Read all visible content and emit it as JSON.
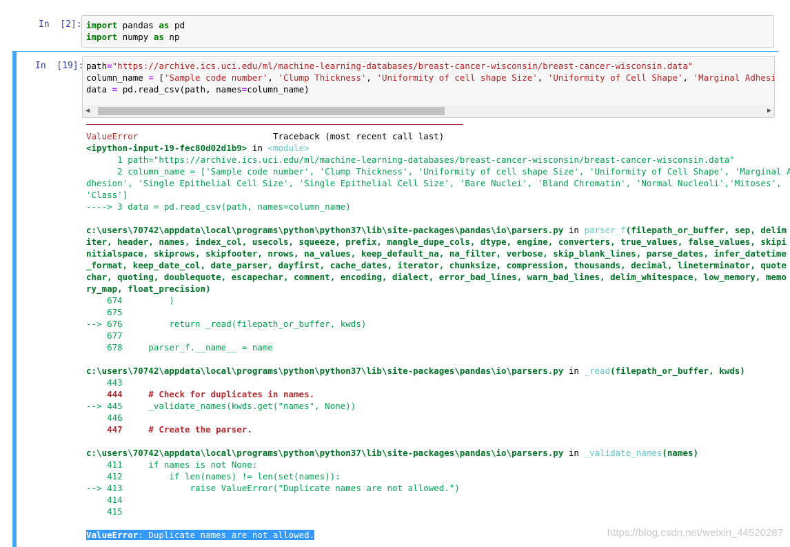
{
  "cell1": {
    "prompt": "In  [2]:",
    "lines": [
      "import pandas as pd",
      "import numpy as np"
    ]
  },
  "cell2": {
    "prompt": "In  [19]:",
    "line1": "path=\"https://archive.ics.uci.edu/ml/machine-learning-databases/breast-cancer-wisconsin/breast-cancer-wisconsin.data\"",
    "line2": "column_name = ['Sample code number', 'Clump Thickness', 'Uniformity of cell shape Size', 'Uniformity of Cell Shape', 'Marginal Adhesion', 'Sing",
    "line3": "data = pd.read_csv(path, names=column_name)"
  },
  "traceback": {
    "header_error": "ValueError",
    "header_traceback": "Traceback (most recent call last)",
    "frame1_loc": "<ipython-input-19-fec80d02d1b9>",
    "frame1_in": "in",
    "frame1_module": "<module>",
    "frame1_l1": "      1 path=\"https://archive.ics.uci.edu/ml/machine-learning-databases/breast-cancer-wisconsin/breast-cancer-wisconsin.data\"",
    "frame1_l2a": "      2 column_name = ['Sample code number', 'Clump Thickness', 'Uniformity of cell shape Size', 'Uniformity of Cell Shape', 'Marginal A",
    "frame1_l2b": "dhesion', 'Single Epithelial Cell Size', 'Single Epithelial Cell Size', 'Bare Nuclei', 'Bland Chromatin', 'Normal Nucleoli','Mitoses',",
    "frame1_l2c": "'Class']",
    "frame1_l3": "----> 3 data = pd.read_csv(path, names=column_name)",
    "frame2_path": "c:\\users\\70742\\appdata\\local\\programs\\python\\python37\\lib\\site-packages\\pandas\\io\\parsers.py",
    "frame2_fn": "parser_f",
    "frame2_args": [
      "(filepath_or_buffer, sep, delim",
      "iter, header, names, index_col, usecols, squeeze, prefix, mangle_dupe_cols, dtype, engine, converters, true_values, false_values, skipi",
      "nitialspace, skiprows, skipfooter, nrows, na_values, keep_default_na, na_filter, verbose, skip_blank_lines, parse_dates, infer_datetime",
      "_format, keep_date_col, date_parser, dayfirst, cache_dates, iterator, chunksize, compression, thousands, decimal, lineterminator, quote",
      "char, quoting, doublequote, escapechar, comment, encoding, dialect, error_bad_lines, warn_bad_lines, delim_whitespace, low_memory, memo",
      "ry_map, float_precision)"
    ],
    "frame2_lines": [
      "    674         )",
      "    675",
      "--> 676         return _read(filepath_or_buffer, kwds)",
      "    677",
      "    678     parser_f.__name__ = name"
    ],
    "frame3_path": "c:\\users\\70742\\appdata\\local\\programs\\python\\python37\\lib\\site-packages\\pandas\\io\\parsers.py",
    "frame3_fn": "_read",
    "frame3_args": "(filepath_or_buffer, kwds)",
    "frame3_lines": [
      "    443",
      "    444     # Check for duplicates in names.",
      "--> 445     _validate_names(kwds.get(\"names\", None))",
      "    446",
      "    447     # Create the parser."
    ],
    "frame4_path": "c:\\users\\70742\\appdata\\local\\programs\\python\\python37\\lib\\site-packages\\pandas\\io\\parsers.py",
    "frame4_fn": "_validate_names",
    "frame4_args": "(names)",
    "frame4_lines": [
      "    411     if names is not None:",
      "    412         if len(names) != len(set(names)):",
      "--> 413             raise ValueError(\"Duplicate names are not allowed.\")",
      "    414",
      "    415"
    ],
    "final_error": "ValueError",
    "final_msg": ": Duplicate names are not allowed."
  },
  "watermark": "https://blog.csdn.net/weixin_44520287"
}
